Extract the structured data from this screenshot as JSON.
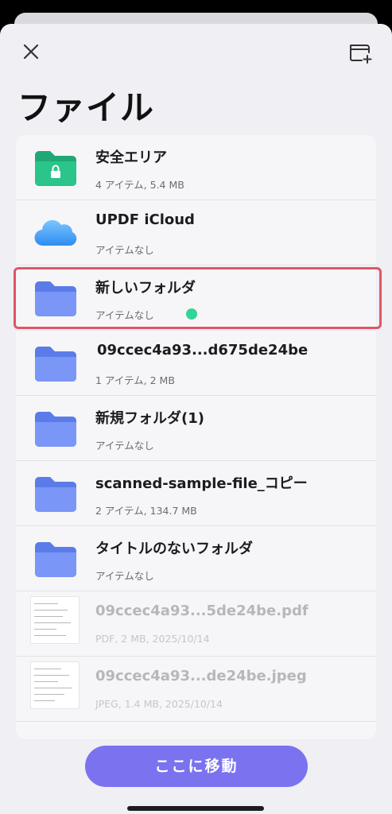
{
  "header": {
    "title": "ファイル",
    "close_icon": "close-icon",
    "new_folder_icon": "new-folder-icon"
  },
  "items": [
    {
      "name": "安全エリア",
      "meta": "4 アイテム, 5.4 MB",
      "icon": "secure-folder-icon"
    },
    {
      "name": "UPDF iCloud",
      "meta": "アイテムなし",
      "icon": "icloud-icon"
    },
    {
      "name": "新しいフォルダ",
      "meta": "アイテムなし",
      "icon": "folder-icon"
    },
    {
      "name": "09ccec4a93...d675de24be",
      "meta": "1 アイテム, 2 MB",
      "icon": "folder-icon"
    },
    {
      "name": "新規フォルダ(1)",
      "meta": "アイテムなし",
      "icon": "folder-icon"
    },
    {
      "name": "scanned-sample-file_コピー",
      "meta": "2 アイテム, 134.7 MB",
      "icon": "folder-icon"
    },
    {
      "name": "タイトルのないフォルダ",
      "meta": "アイテムなし",
      "icon": "folder-icon"
    },
    {
      "name": "09ccec4a93...5de24be.pdf",
      "meta": "PDF, 2 MB, 2025/10/14",
      "icon": "document-thumbnail"
    },
    {
      "name": "09ccec4a93...de24be.jpeg",
      "meta": "JPEG, 1.4 MB, 2025/10/14",
      "icon": "document-thumbnail"
    }
  ],
  "footer": {
    "move_label": "ここに移動"
  },
  "colors": {
    "folder": "#6f8ff5",
    "secure_folder": "#2bbf86",
    "highlight": "#e05564",
    "indicator": "#34d399",
    "button": "#7b72f0"
  }
}
